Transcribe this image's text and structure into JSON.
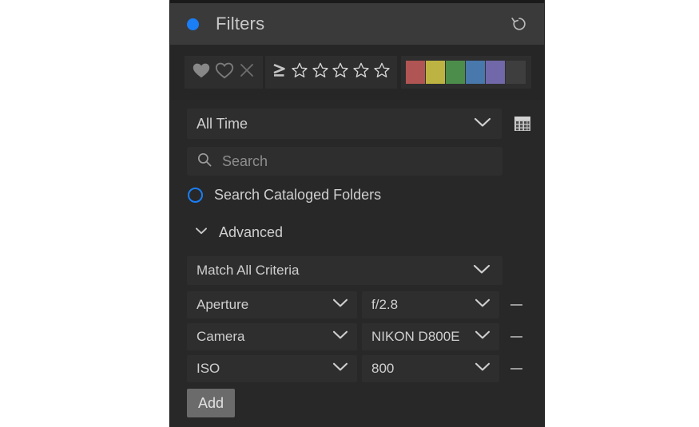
{
  "panel": {
    "accent_color": "#1a7ef5",
    "background": "#282828",
    "header": {
      "title": "Filters",
      "status_dot": "blue-dot-icon",
      "reset_icon": "reset-arrow-icon"
    }
  },
  "rating_bar": {
    "flags": [
      {
        "name": "flag-pick-icon",
        "glyph": "filled-heart",
        "state": "on"
      },
      {
        "name": "flag-unflagged-icon",
        "glyph": "outline-heart",
        "state": "off"
      },
      {
        "name": "flag-reject-icon",
        "glyph": "x-mark",
        "state": "off"
      }
    ],
    "rating": {
      "comparator": "≥",
      "star_count": 5,
      "selected": 0
    },
    "color_labels": [
      {
        "name": "color-label-red",
        "hex": "#b05553"
      },
      {
        "name": "color-label-yellow",
        "hex": "#bdb342"
      },
      {
        "name": "color-label-green",
        "hex": "#4d8d4c"
      },
      {
        "name": "color-label-blue",
        "hex": "#4878ac"
      },
      {
        "name": "color-label-purple",
        "hex": "#7068a8"
      },
      {
        "name": "color-label-none",
        "hex": "#3e3e3e"
      }
    ]
  },
  "date_filter": {
    "value": "All Time",
    "calendar_icon": "calendar-icon"
  },
  "search": {
    "placeholder": "Search",
    "value": "",
    "icon": "search-icon"
  },
  "cataloged": {
    "label": "Search Cataloged Folders",
    "checked": true
  },
  "advanced": {
    "label": "Advanced",
    "expanded": true,
    "chevron": "chevron-down-icon"
  },
  "match": {
    "value": "Match All Criteria"
  },
  "criteria": [
    {
      "key": "Aperture",
      "value": "f/2.8"
    },
    {
      "key": "Camera",
      "value": "NIKON D800E"
    },
    {
      "key": "ISO",
      "value": "800"
    }
  ],
  "add_button": {
    "label": "Add"
  }
}
